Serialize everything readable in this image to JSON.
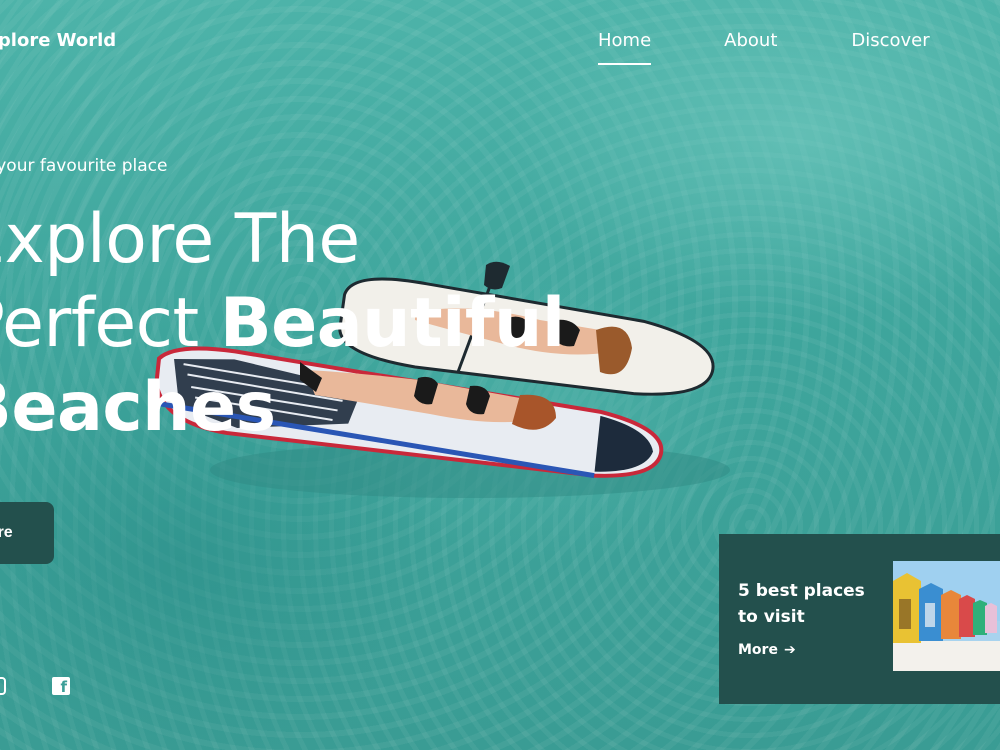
{
  "brand": {
    "name": "Explore World"
  },
  "nav": {
    "items": [
      {
        "label": "Home",
        "active": true
      },
      {
        "label": "About",
        "active": false
      },
      {
        "label": "Discover",
        "active": false
      }
    ]
  },
  "hero": {
    "eyebrow": "Find your favourite place",
    "headline_line1": "Explore The",
    "headline_line2_light": "Perfect ",
    "headline_line2_bold": "Beautiful",
    "headline_line3": "Beaches",
    "cta_label": "Explore"
  },
  "social": {
    "icons": [
      "instagram-icon",
      "facebook-icon"
    ]
  },
  "promo": {
    "title": "5 best places to visit",
    "more_label": "More",
    "arrow": "➔"
  },
  "colors": {
    "accent_dark": "#23504d",
    "sea": "#3fa39b",
    "text": "#ffffff"
  }
}
